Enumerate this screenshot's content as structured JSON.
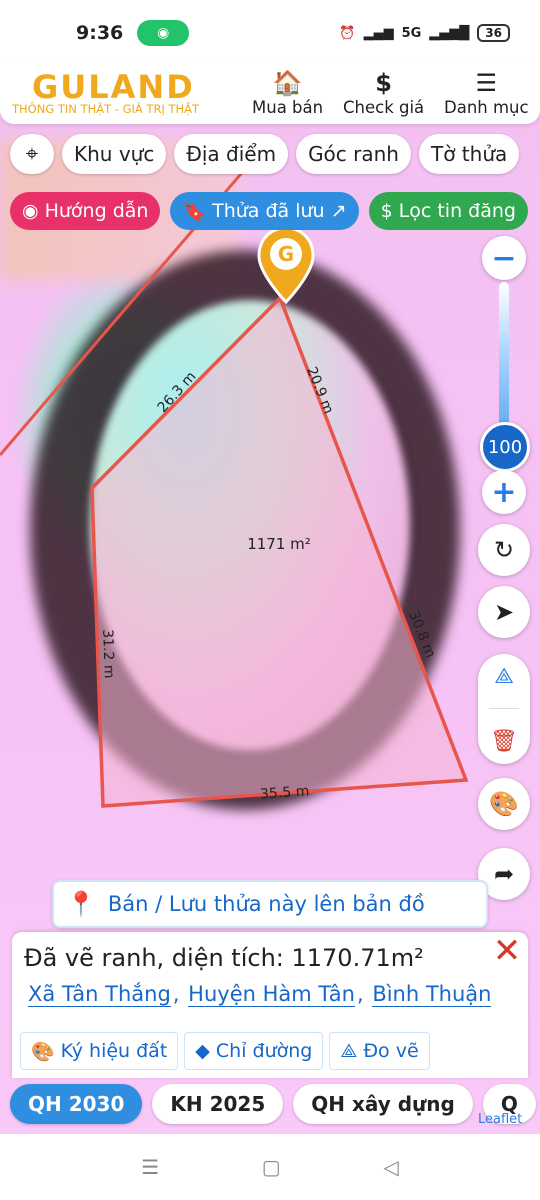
{
  "status_bar": {
    "time": "9:36",
    "battery": "36",
    "signal": "5G"
  },
  "header": {
    "logo": "GULAND",
    "tagline": "THÔNG TIN THẬT - GIÁ TRỊ THẬT",
    "nav": [
      {
        "label": "Mua bán",
        "icon": "building-icon"
      },
      {
        "label": "Check giá",
        "icon": "dollar-icon"
      },
      {
        "label": "Danh mục",
        "icon": "menu-icon"
      }
    ]
  },
  "chips": [
    "Khu vực",
    "Địa điểm",
    "Góc ranh",
    "Tờ thửa"
  ],
  "actions": {
    "guide": "Hướng dẫn",
    "saved": "Thửa đã lưu ↗",
    "filter": "Lọc tin đăng"
  },
  "colors": {
    "guide": "#e8316a",
    "saved": "#2f8ee0",
    "filter": "#2fa84f",
    "accent": "#1767c8",
    "parcel_edge": "#e8554a"
  },
  "zoom": {
    "level": "100"
  },
  "parcel": {
    "area_label": "1171 m²",
    "edges": [
      "26.3 m",
      "20.9 m",
      "30.8 m",
      "35.5 m",
      "31.2 m"
    ]
  },
  "cta": {
    "label": "Bán / Lưu thửa này lên bản đồ"
  },
  "sheet": {
    "title": "Đã vẽ ranh, diện tích: 1170.71m²",
    "commune": "Xã Tân Thắng",
    "district": "Huyện Hàm Tân",
    "province": "Bình Thuận",
    "buttons": [
      "Ký hiệu đất",
      "Chỉ đường",
      "Đo vẽ"
    ]
  },
  "tabs": [
    "QH 2030",
    "KH 2025",
    "QH xây dựng",
    "Q"
  ],
  "attribution": "Leaflet"
}
